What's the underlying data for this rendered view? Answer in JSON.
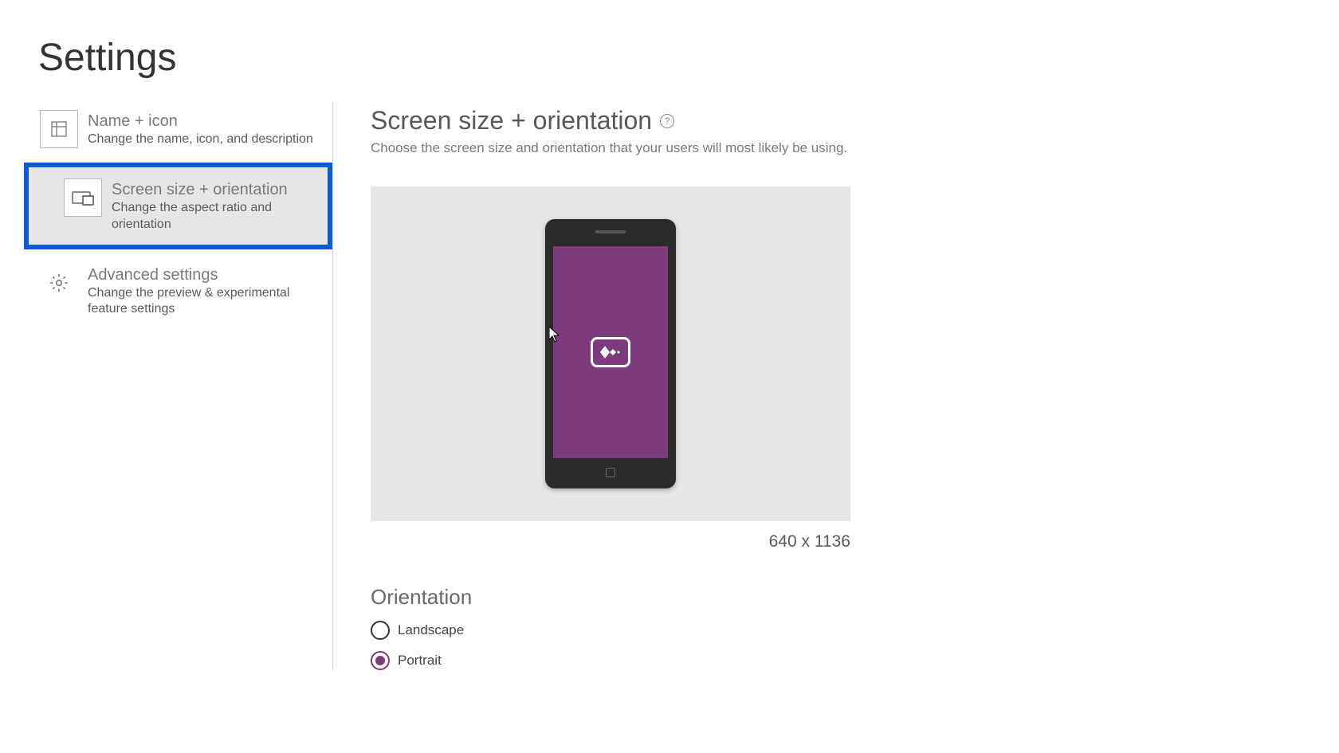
{
  "page_title": "Settings",
  "sidebar": {
    "items": [
      {
        "title": "Name + icon",
        "desc": "Change the name, icon, and description"
      },
      {
        "title": "Screen size + orientation",
        "desc": "Change the aspect ratio and orientation"
      },
      {
        "title": "Advanced settings",
        "desc": "Change the preview & experimental feature settings"
      }
    ]
  },
  "main": {
    "title": "Screen size + orientation",
    "help_symbol": "?",
    "desc": "Choose the screen size and orientation that your users will most likely be using.",
    "dimensions": "640 x 1136",
    "orientation_label": "Orientation",
    "options": {
      "landscape": "Landscape",
      "portrait": "Portrait"
    }
  }
}
